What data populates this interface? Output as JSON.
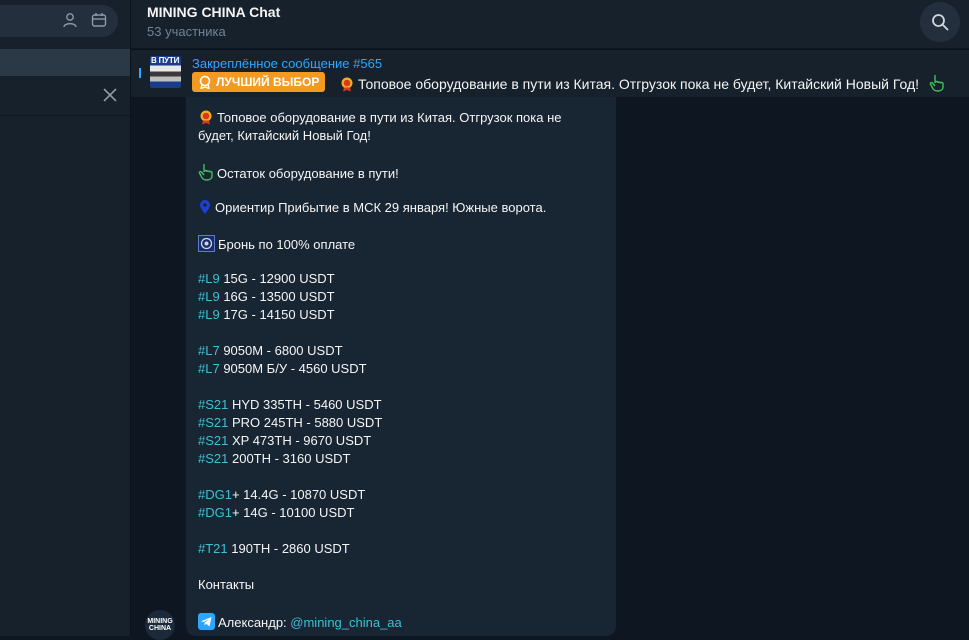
{
  "header": {
    "title": "MINING CHINA Chat",
    "subtitle": "53 участника"
  },
  "pinned": {
    "title": "Закреплённое сообщение #565",
    "badge": "ЛУЧШИЙ ВЫБОР",
    "text": "Топовое оборудование в пути из Китая. Отгрузок пока не будет, Китайский Новый Год!",
    "thumb_text": "В ПУТИ"
  },
  "message": {
    "intro_line1": "Топовое оборудование в пути из Китая. Отгрузок пока не",
    "intro_line2": "будет, Китайский Новый Год!",
    "remainder": "Остаток оборудование в пути!",
    "landmark": "Ориентир Прибытие в МСК 29 января! Южные ворота.",
    "booking": "Бронь по 100% оплате",
    "prices": [
      {
        "tag": "#L9",
        "text": " 15G - 12900 USDT"
      },
      {
        "tag": "#L9",
        "text": " 16G - 13500 USDT"
      },
      {
        "tag": "#L9",
        "text": " 17G - 14150 USDT"
      },
      {
        "tag": "#L7",
        "text": " 9050M - 6800 USDT"
      },
      {
        "tag": "#L7",
        "text": " 9050M Б/У - 4560 USDT"
      },
      {
        "tag": "#S21",
        "text": " HYD 335TH - 5460 USDT"
      },
      {
        "tag": "#S21",
        "text": " PRO 245TH - 5880 USDT"
      },
      {
        "tag": "#S21",
        "text": " XP 473TH - 9670 USDT"
      },
      {
        "tag": "#S21",
        "text": " 200TH - 3160 USDT"
      },
      {
        "tag": "#DG1",
        "text": "+ 14.4G - 10870 USDT"
      },
      {
        "tag": "#DG1",
        "text": "+ 14G - 10100 USDT"
      },
      {
        "tag": "#T21",
        "text": " 190TH - 2860 USDT"
      }
    ],
    "contacts_label": "Контакты",
    "contact_name": "Александр: ",
    "contact_link": "@mining_china_aa"
  },
  "avatar": {
    "text": "MINING CHINA"
  },
  "icons": {
    "search": "search-icon",
    "user": "user-icon",
    "calendar": "calendar-icon",
    "close": "close-icon",
    "medal": "medal-icon",
    "pointing_hand": "pointing-hand-icon",
    "pin": "location-pin-icon",
    "chip": "chip-icon",
    "telegram": "telegram-icon"
  },
  "colors": {
    "accent": "#2ea6ff",
    "hashtag": "#3ec1d3",
    "badge": "#f39a22",
    "bubble": "#182533",
    "background": "#0e1621"
  }
}
